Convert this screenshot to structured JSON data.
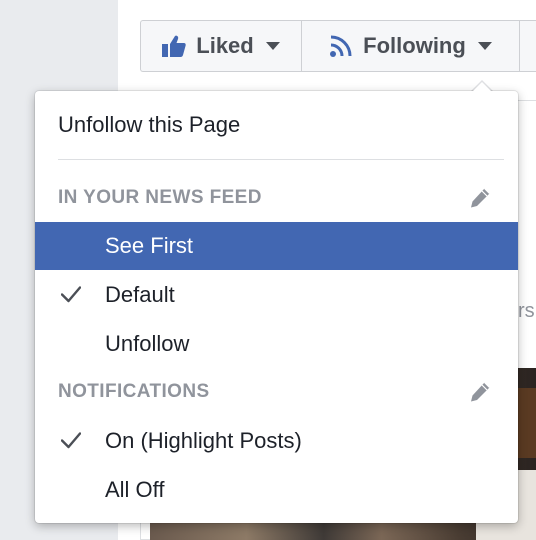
{
  "page": {
    "background_text": "rs"
  },
  "action_bar": {
    "liked_label": "Liked",
    "following_label": "Following"
  },
  "dropdown": {
    "unfollow_page": "Unfollow this Page",
    "news_feed": {
      "header": "IN YOUR NEWS FEED",
      "options": [
        {
          "label": "See First",
          "checked": false,
          "highlighted": true
        },
        {
          "label": "Default",
          "checked": true,
          "highlighted": false
        },
        {
          "label": "Unfollow",
          "checked": false,
          "highlighted": false
        }
      ]
    },
    "notifications": {
      "header": "NOTIFICATIONS",
      "options": [
        {
          "label": "On (Highlight Posts)",
          "checked": true,
          "highlighted": false
        },
        {
          "label": "All Off",
          "checked": false,
          "highlighted": false
        }
      ]
    }
  },
  "colors": {
    "accent": "#4267b2",
    "header_text": "#90949c",
    "body_text": "#1d2129",
    "button_text": "#4b4f56"
  },
  "icons": {
    "liked": "thumbs-up-icon",
    "following": "rss-icon",
    "caret": "caret-down-icon",
    "edit": "pencil-icon",
    "check": "check-icon"
  }
}
